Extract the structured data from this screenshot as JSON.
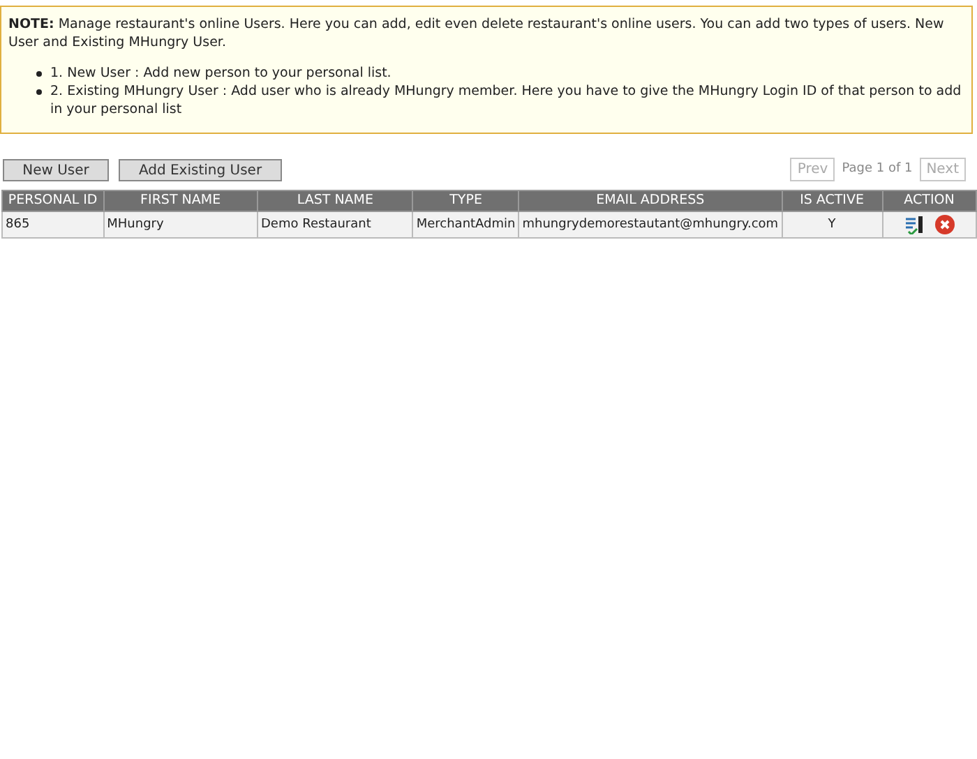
{
  "note": {
    "label": "NOTE:",
    "text": "Manage restaurant's online Users. Here you can add, edit even delete restaurant's online users. You can add two types of users. New User and Existing MHungry User.",
    "items": [
      "1. New User : Add new person to your personal list.",
      "2. Existing MHungry User : Add user who is already MHungry member. Here you have to give the MHungry Login ID of that person to add in your personal list"
    ]
  },
  "buttons": [
    "New User",
    "Add Existing User"
  ],
  "pager": {
    "prev": {
      "label": "Prev",
      "disabled": true
    },
    "info": "Page 1 of 1",
    "next": {
      "label": "Next",
      "disabled": true
    }
  },
  "table": {
    "columns": [
      "PERSONAL ID",
      "FIRST NAME",
      "LAST NAME",
      "TYPE",
      "EMAIL ADDRESS",
      "IS ACTIVE",
      "ACTION"
    ],
    "rows": [
      {
        "cells": [
          "865",
          "MHungry",
          "Demo Restaurant",
          "MerchantAdmin",
          "mhungrydemorestautant@mhungry.com",
          "Y"
        ]
      }
    ]
  }
}
